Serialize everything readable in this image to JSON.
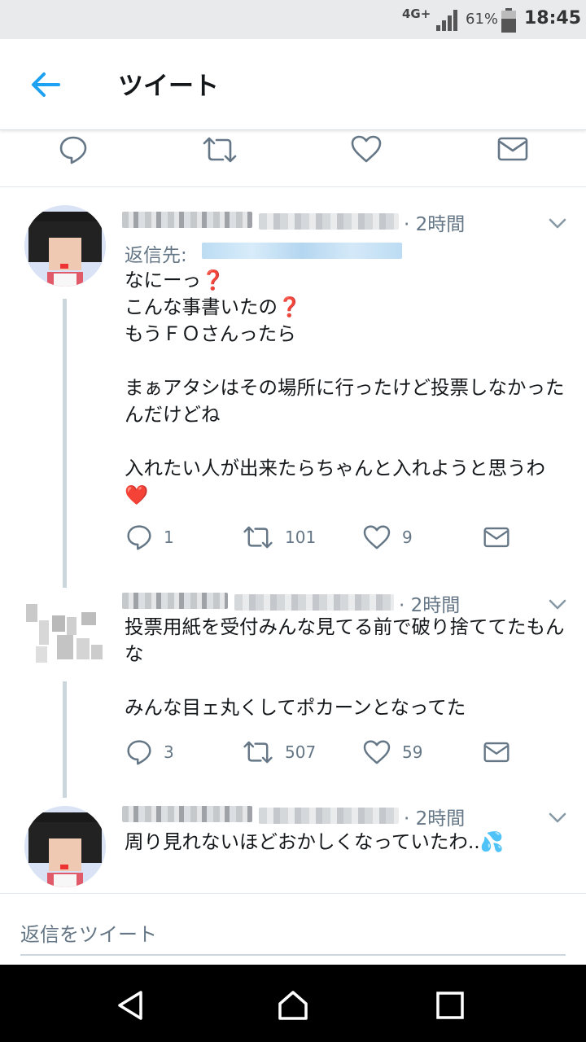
{
  "status_bar": {
    "network": "4G+",
    "battery": "61%",
    "time": "18:45"
  },
  "header": {
    "title": "ツイート"
  },
  "tweets": [
    {
      "time": "· 2時間",
      "reply_to_label": "返信先:",
      "body": "なにーっ❓\nこんな事書いたの❓\nもうＦＯさんったら\n\nまぁアタシはその場所に行ったけど投票しなかったんだけどね\n\n入れたい人が出来たらちゃんと入れようと思うわ❤️",
      "counts": {
        "reply": "1",
        "retweet": "101",
        "like": "9"
      }
    },
    {
      "time": "· 2時間",
      "body": "投票用紙を受付みんな見てる前で破り捨ててたもんな\n\nみんな目ェ丸くしてポカーンとなってた",
      "counts": {
        "reply": "3",
        "retweet": "507",
        "like": "59"
      }
    },
    {
      "time": "· 2時間",
      "body": "周り見れないほどおかしくなっていたわ..💦"
    }
  ],
  "reply_bar": {
    "placeholder": "返信をツイート"
  },
  "icons": [
    "back-arrow-icon",
    "reply-icon",
    "retweet-icon",
    "like-icon",
    "dm-icon",
    "caret-icon",
    "nav-back-icon",
    "nav-home-icon",
    "nav-recents-icon"
  ],
  "colors": {
    "accent": "#1da1f2",
    "icon_gray": "#657786",
    "text": "#14171a",
    "heart": "#e0245e"
  }
}
